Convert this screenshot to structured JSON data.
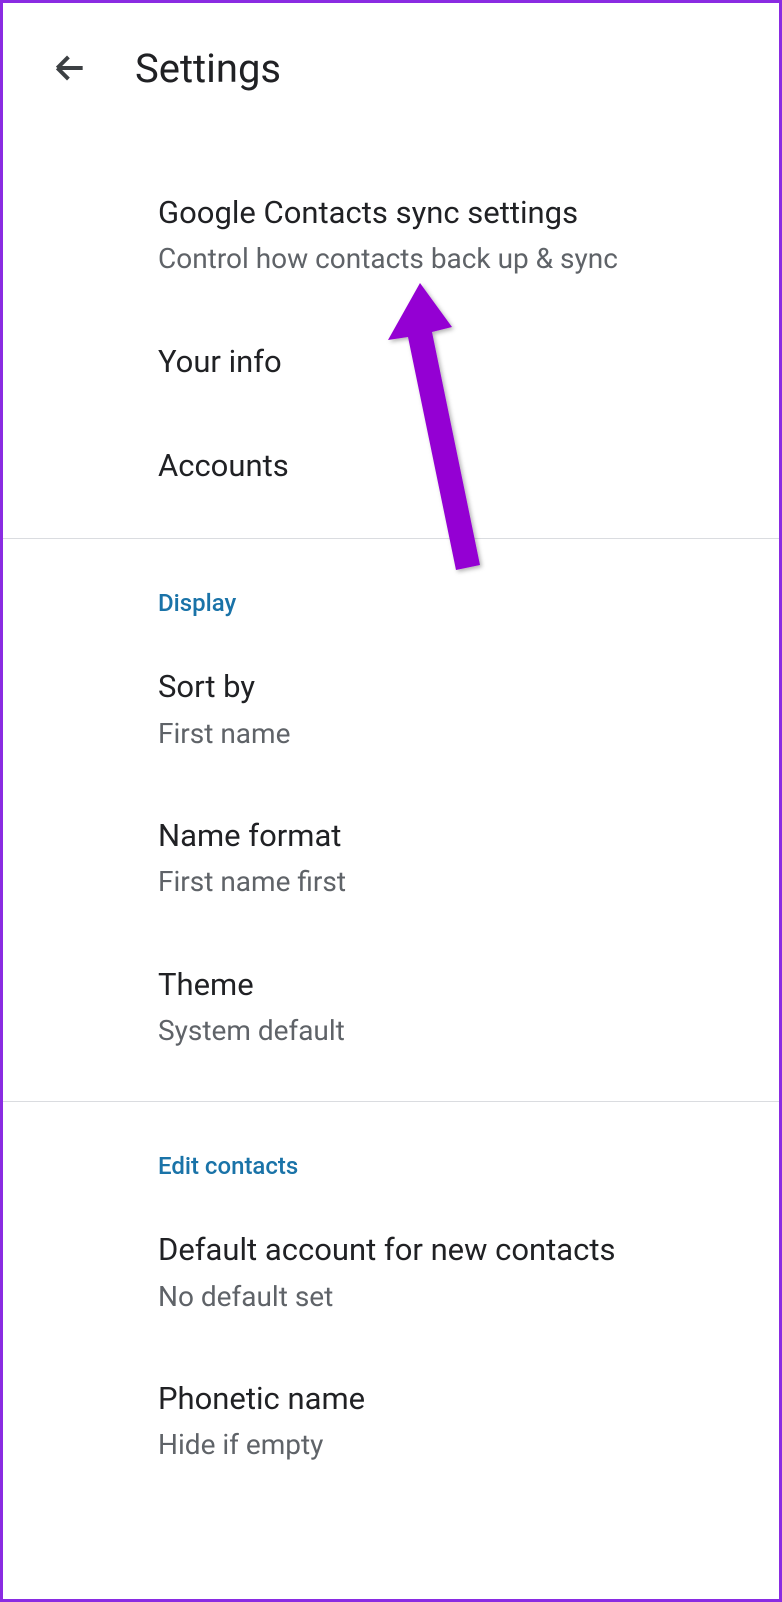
{
  "header": {
    "title": "Settings"
  },
  "sections": {
    "main": {
      "items": [
        {
          "title": "Google Contacts sync settings",
          "subtitle": "Control how contacts back up & sync"
        },
        {
          "title": "Your info"
        },
        {
          "title": "Accounts"
        }
      ]
    },
    "display": {
      "header": "Display",
      "items": [
        {
          "title": "Sort by",
          "subtitle": "First name"
        },
        {
          "title": "Name format",
          "subtitle": "First name first"
        },
        {
          "title": "Theme",
          "subtitle": "System default"
        }
      ]
    },
    "edit": {
      "header": "Edit contacts",
      "items": [
        {
          "title": "Default account for new contacts",
          "subtitle": "No default set"
        },
        {
          "title": "Phonetic name",
          "subtitle": "Hide if empty"
        }
      ]
    }
  }
}
